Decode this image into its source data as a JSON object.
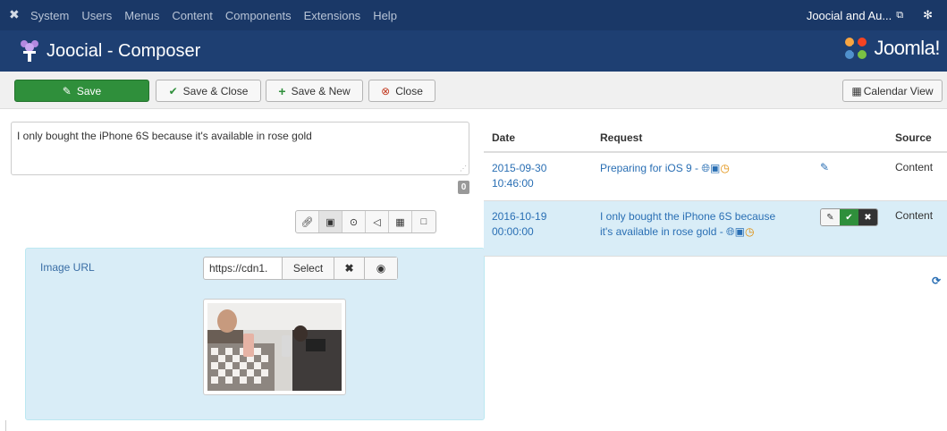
{
  "topbar": {
    "menu": [
      "System",
      "Users",
      "Menus",
      "Content",
      "Components",
      "Extensions",
      "Help"
    ],
    "site_link": "Joocial and Au...",
    "icons": {
      "logo": "joomla-mark-icon",
      "external": "external-link-icon",
      "settings": "gear-icon"
    }
  },
  "header": {
    "title": "Joocial - Composer",
    "logo_text": "Joomla!"
  },
  "toolbar": {
    "save": "Save",
    "save_close": "Save & Close",
    "save_new": "Save & New",
    "close": "Close",
    "calendar_view": "Calendar View"
  },
  "composer": {
    "text": "I only bought the iPhone 6S because it's available in rose gold",
    "char_counter": "0",
    "tools": [
      "link-icon",
      "image-icon",
      "target-icon",
      "megaphone-icon",
      "calendar-icon",
      "calendar-blank-icon"
    ]
  },
  "image_panel": {
    "label": "Image URL",
    "url_value": "https://cdn1.",
    "select_label": "Select",
    "clear_icon": "close-icon",
    "preview_icon": "eye-icon"
  },
  "table": {
    "headers": {
      "date": "Date",
      "request": "Request",
      "source": "Source"
    },
    "rows": [
      {
        "date_line1": "2015-09-30",
        "date_line2": "10:46:00",
        "request": "Preparing for iOS 9 -",
        "source": "Content"
      },
      {
        "date_line1": "2016-10-19",
        "date_line2": "00:00:00",
        "request_line1": "I only bought the iPhone 6S because",
        "request_line2": "it's available in rose gold -",
        "source": "Content"
      }
    ]
  },
  "colors": {
    "navbar": "#1a3867",
    "header": "#1e3f72",
    "save": "#2f8f3b",
    "link": "#2a6fb4",
    "panel": "#d9edf7"
  }
}
